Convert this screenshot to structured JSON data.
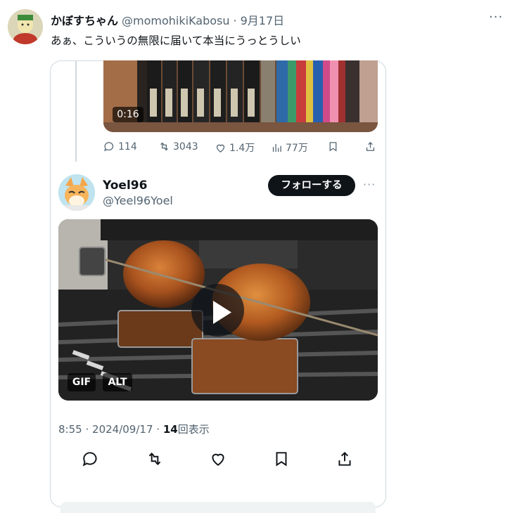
{
  "outer_tweet": {
    "display_name": "かぼすちゃん",
    "handle": "@momohikiKabosu",
    "separator": "·",
    "date": "9月17日",
    "text": "あぁ、こういうの無限に届いて本当にうっとうしい",
    "more_label": "···"
  },
  "previous_tweet": {
    "video_duration": "0:16",
    "actions": {
      "replies": "114",
      "retweets": "3043",
      "likes": "1.4万",
      "views": "77万"
    }
  },
  "quoted_tweet": {
    "display_name": "Yoel96",
    "handle": "@Yeel96Yoel",
    "follow_label": "フォローする",
    "more_label": "···",
    "badges": {
      "gif": "GIF",
      "alt": "ALT"
    },
    "time": "8:55",
    "separator": "·",
    "date": "2024/09/17",
    "separator2": "·",
    "views_count": "14",
    "views_label": "回表示"
  },
  "colors": {
    "text_primary": "#0f1419",
    "text_secondary": "#536471",
    "border": "#cfd9de",
    "follow_bg": "#0f1419"
  },
  "icons": [
    "reply-icon",
    "retweet-icon",
    "like-icon",
    "views-icon",
    "bookmark-icon",
    "share-icon",
    "play-icon"
  ]
}
